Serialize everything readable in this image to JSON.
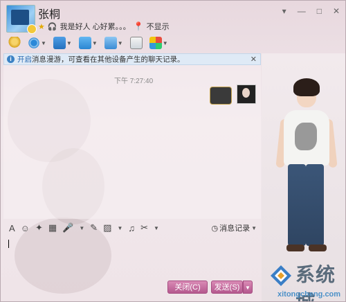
{
  "contact": {
    "name": "张桐",
    "status_text": "我是好人 心好累。。。",
    "location_text": "不显示"
  },
  "window_controls": [
    "▾",
    "—",
    "□",
    "✕"
  ],
  "toolbar": {
    "icons": [
      "voice-call-icon",
      "video-call-icon",
      "share-screen-icon",
      "file-transfer-icon",
      "remote-assist-icon",
      "create-group-icon",
      "apps-icon"
    ]
  },
  "infobar": {
    "link": "开启",
    "text": "消息漫游，可查看在其他设备产生的聊天记录。"
  },
  "chat": {
    "timestamp": "下午 7:27:40"
  },
  "edit_toolbar": {
    "message_record": "消息记录"
  },
  "buttons": {
    "close": "关闭(C)",
    "send": "发送(S)"
  },
  "watermark": {
    "brand": "系统城",
    "url": "xitongcheng.com"
  },
  "colors": {
    "accent": "#b5588e",
    "info_bg": "#dfeaf6",
    "link": "#2b6cb3"
  }
}
